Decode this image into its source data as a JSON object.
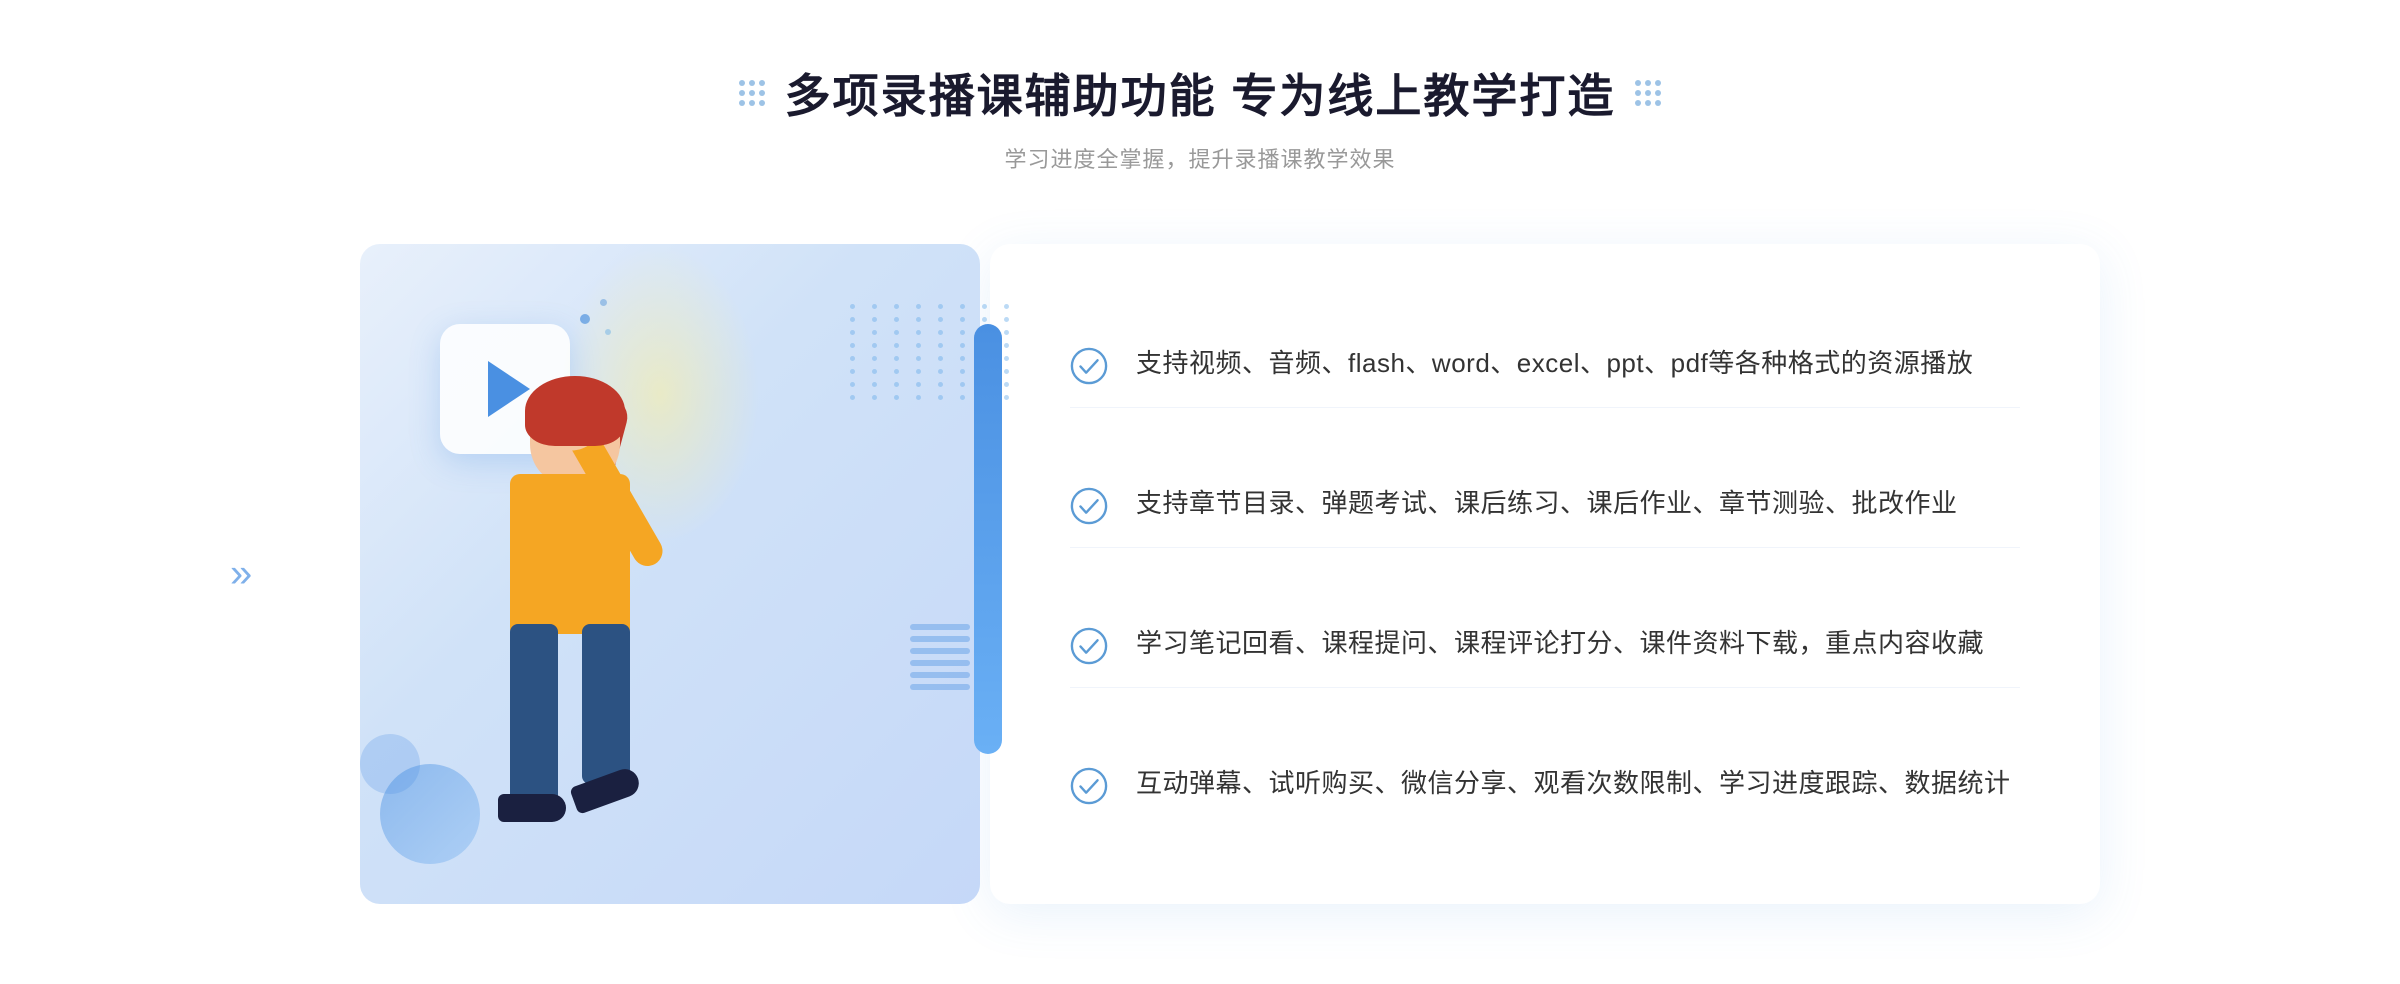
{
  "header": {
    "title": "多项录播课辅助功能 专为线上教学打造",
    "subtitle": "学习进度全掌握，提升录播课教学效果"
  },
  "features": [
    {
      "id": 1,
      "text": "支持视频、音频、flash、word、excel、ppt、pdf等各种格式的资源播放"
    },
    {
      "id": 2,
      "text": "支持章节目录、弹题考试、课后练习、课后作业、章节测验、批改作业"
    },
    {
      "id": 3,
      "text": "学习笔记回看、课程提问、课程评论打分、课件资料下载，重点内容收藏"
    },
    {
      "id": 4,
      "text": "互动弹幕、试听购买、微信分享、观看次数限制、学习进度跟踪、数据统计"
    }
  ],
  "colors": {
    "primary": "#4a90e2",
    "title": "#1a1a2e",
    "subtitle": "#999999",
    "feature_text": "#333333",
    "check_color": "#5b9bd5"
  },
  "icons": {
    "check": "circle-check",
    "play": "play-triangle",
    "left_arrow": "«",
    "right_dots": "grid-dots"
  }
}
